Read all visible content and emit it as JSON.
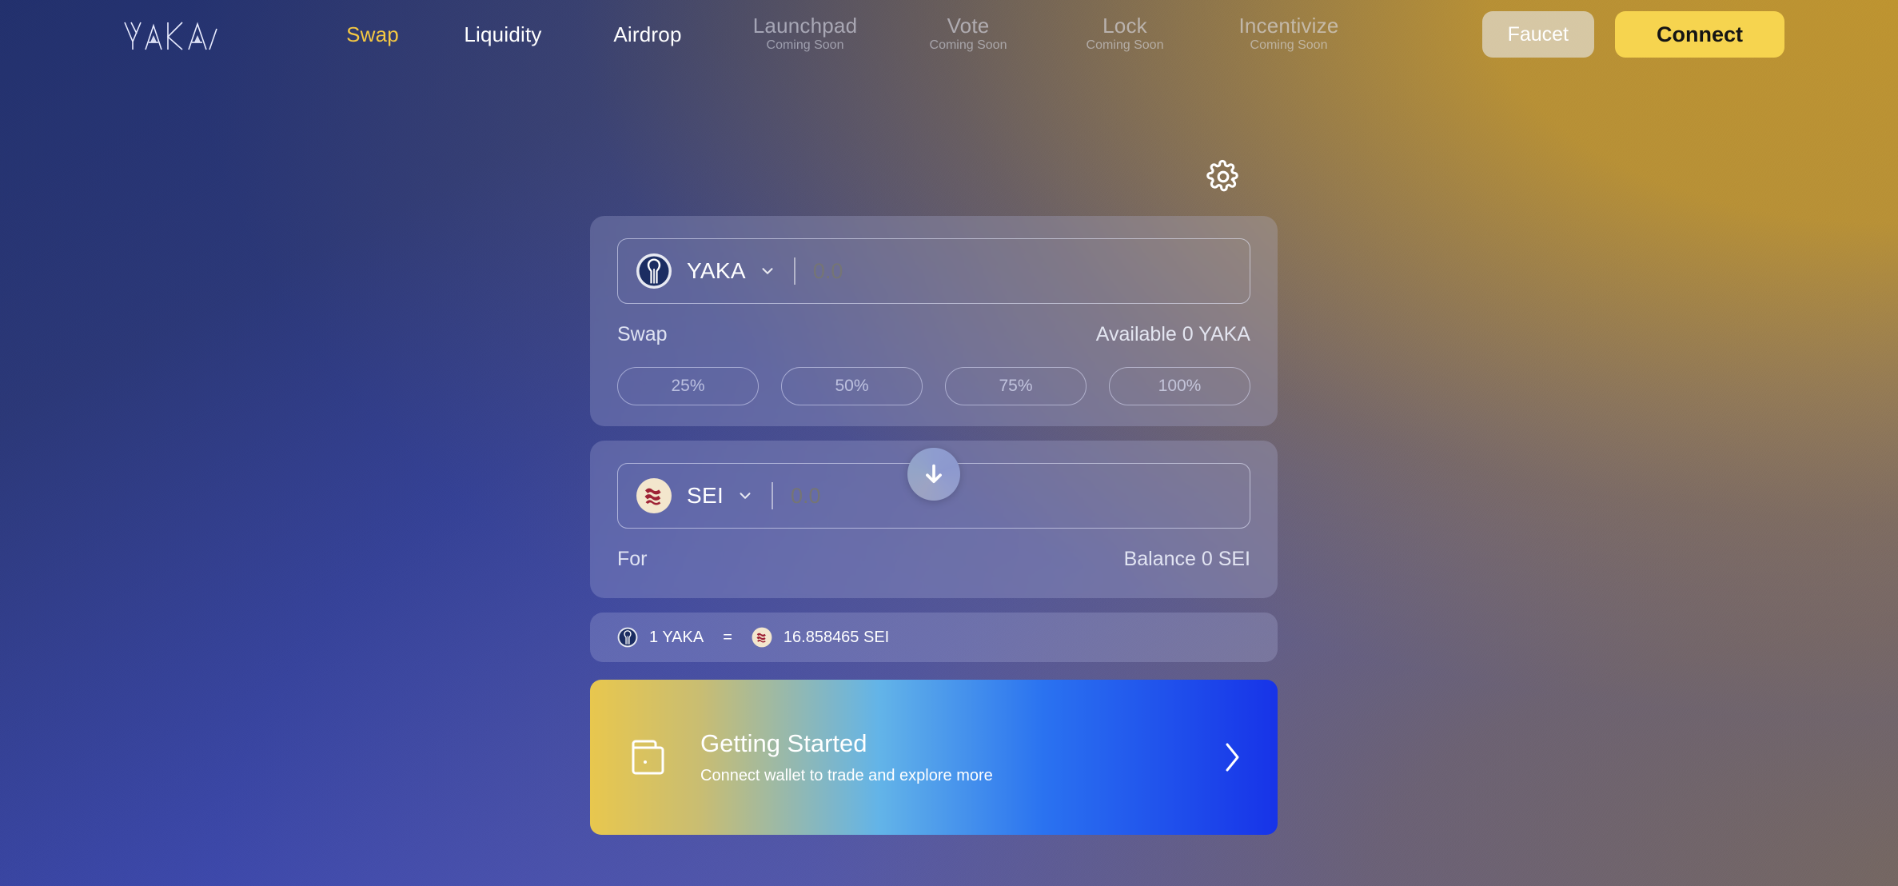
{
  "brand": {
    "logo_text": "YAKA"
  },
  "nav": {
    "items": [
      {
        "label": "Swap",
        "sub": "",
        "state": "active"
      },
      {
        "label": "Liquidity",
        "sub": "",
        "state": "normal"
      },
      {
        "label": "Airdrop",
        "sub": "",
        "state": "normal"
      },
      {
        "label": "Launchpad",
        "sub": "Coming Soon",
        "state": "soon"
      },
      {
        "label": "Vote",
        "sub": "Coming Soon",
        "state": "soon"
      },
      {
        "label": "Lock",
        "sub": "Coming Soon",
        "state": "soon"
      },
      {
        "label": "Incentivize",
        "sub": "Coming Soon",
        "state": "soon"
      }
    ],
    "faucet_label": "Faucet",
    "connect_label": "Connect"
  },
  "settings": {
    "icon": "gear-icon"
  },
  "swap": {
    "from": {
      "token": "YAKA",
      "token_icon": "yaka-token-icon",
      "amount_value": "",
      "amount_placeholder": "0.0",
      "label": "Swap",
      "balance_text": "Available 0 YAKA",
      "percents": [
        "25%",
        "50%",
        "75%",
        "100%"
      ]
    },
    "direction_icon": "arrow-down-icon",
    "to": {
      "token": "SEI",
      "token_icon": "sei-token-icon",
      "amount_value": "",
      "amount_placeholder": "0.0",
      "label": "For",
      "balance_text": "Balance 0 SEI"
    },
    "rate": {
      "base_amount": "1 YAKA",
      "equals": "=",
      "quote_amount": "16.858465 SEI"
    }
  },
  "banner": {
    "icon": "wallet-icon",
    "title": "Getting Started",
    "subtitle": "Connect wallet to trade and explore more",
    "chevron": "chevron-right-icon"
  },
  "colors": {
    "accent_yellow": "#f6d44f",
    "nav_active": "#f5c842",
    "bg_navy": "#22306d",
    "bg_gold": "#be9430",
    "bg_periwinkle": "#4a52c0",
    "banner_gradient_start": "#e8c74e",
    "banner_gradient_end": "#1733e8"
  }
}
